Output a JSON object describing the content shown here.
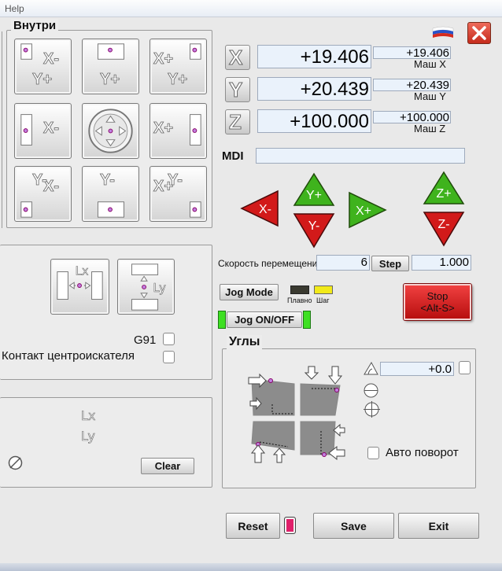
{
  "menu": {
    "help": "Help"
  },
  "inside_panel": {
    "title": "Внутри",
    "buttons": [
      {
        "x_text": "X-",
        "y_text": "Y+"
      },
      {
        "x_text": "",
        "y_text": "Y+"
      },
      {
        "x_text": "X+",
        "y_text": "Y+"
      },
      {
        "x_text": "X-",
        "y_text": ""
      },
      {
        "x_text": "",
        "y_text": ""
      },
      {
        "x_text": "X+",
        "y_text": ""
      },
      {
        "x_text": "X-",
        "y_text": "Y-"
      },
      {
        "x_text": "",
        "y_text": "Y-"
      },
      {
        "x_text": "X+",
        "y_text": "Y-"
      }
    ]
  },
  "dro": {
    "x": {
      "letter": "X",
      "value": "+19.406",
      "machine": "+19.406",
      "machine_label": "Маш X"
    },
    "y": {
      "letter": "Y",
      "value": "+20.439",
      "machine": "+20.439",
      "machine_label": "Маш Y"
    },
    "z": {
      "letter": "Z",
      "value": "+100.000",
      "machine": "+100.000",
      "machine_label": "Маш Z"
    }
  },
  "mdi": {
    "label": "MDI",
    "value": ""
  },
  "jog_arrows": {
    "x_minus": "X-",
    "y_plus": "Y+",
    "y_minus": "Y-",
    "x_plus": "X+",
    "z_plus": "Z+",
    "z_minus": "Z-"
  },
  "speed": {
    "label": "Скорость перемещений",
    "value": "6",
    "step_label": "Step",
    "step_value": "1.000"
  },
  "jog": {
    "mode_label": "Jog Mode",
    "smooth_label": "Плавно",
    "step_label": "Шаг",
    "on_off_label": "Jog ON/OFF"
  },
  "stop": {
    "line1": "Stop",
    "line2": "<Alt-S>"
  },
  "measure": {
    "lx": "Lx",
    "ly": "Ly",
    "g91": "G91",
    "contact": "Контакт центроискателя"
  },
  "results": {
    "lx": "Lx",
    "ly": "Ly",
    "clear": "Clear"
  },
  "angles": {
    "title": "Углы",
    "angle_value": "+0.0",
    "auto_rotate": "Авто поворот"
  },
  "bottom": {
    "reset": "Reset",
    "save": "Save",
    "exit": "Exit"
  },
  "colors": {
    "red": "#d21a1a",
    "green": "#3fb31d",
    "field_bg": "#eaf2fb",
    "close": "#d93a2b"
  }
}
